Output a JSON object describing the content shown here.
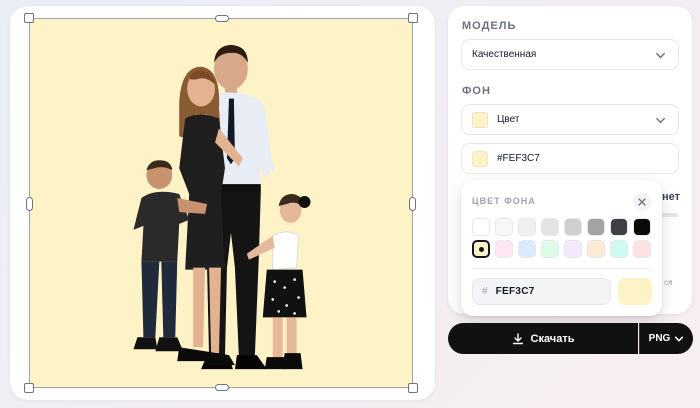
{
  "canvas": {
    "background_color": "#FEF3C7"
  },
  "panel": {
    "model_label": "МОДЕЛЬ",
    "model_value": "Качественная",
    "background_label": "ФОН",
    "background_type": "Цвет",
    "background_hex": "#FEF3C7",
    "partial_text": "нет",
    "partial_small": "ся"
  },
  "popover": {
    "title": "ЦВЕТ ФОНА",
    "hash": "#",
    "hex_value": "FEF3C7",
    "swatches": [
      "#FFFFFF",
      "#F7F7F7",
      "#F0F0F0",
      "#E3E3E3",
      "#CFCFCF",
      "#A3A3A3",
      "#3F3F46",
      "#0A0A0A",
      "#FEF3C7",
      "#FCE7F3",
      "#DBEAFE",
      "#DCFCE7",
      "#F3E8FF",
      "#FDEBD3",
      "#CCFBF1",
      "#FEE2E2"
    ],
    "selected_index": 8
  },
  "download": {
    "label": "Скачать",
    "format": "PNG"
  },
  "icons": [
    "chevron-down-icon",
    "close-icon",
    "download-icon"
  ]
}
